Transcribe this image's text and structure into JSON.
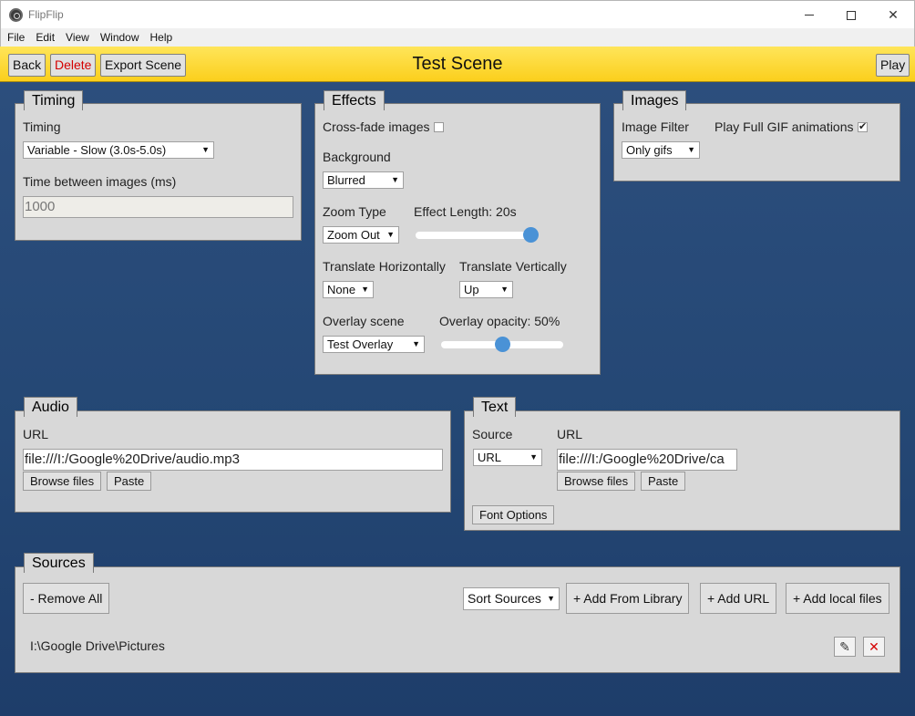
{
  "window": {
    "app_title": "FlipFlip",
    "menu": [
      "File",
      "Edit",
      "View",
      "Window",
      "Help"
    ]
  },
  "header": {
    "back_label": "Back",
    "delete_label": "Delete",
    "export_label": "Export Scene",
    "title": "Test Scene",
    "play_label": "Play"
  },
  "timing": {
    "tab": "Timing",
    "timing_label": "Timing",
    "timing_value": "Variable - Slow (3.0s-5.0s)",
    "between_label": "Time between images (ms)",
    "between_value": "1000"
  },
  "effects": {
    "tab": "Effects",
    "crossfade_label": "Cross-fade images",
    "crossfade_checked": false,
    "background_label": "Background",
    "background_value": "Blurred",
    "zoom_label": "Zoom Type",
    "zoom_value": "Zoom Out",
    "effect_length_label": "Effect Length: 20s",
    "effect_length_fraction": 1.0,
    "translate_h_label": "Translate Horizontally",
    "translate_h_value": "None",
    "translate_v_label": "Translate Vertically",
    "translate_v_value": "Up",
    "overlay_label": "Overlay scene",
    "overlay_value": "Test Overlay",
    "overlay_opacity_label": "Overlay opacity: 50%",
    "overlay_opacity_fraction": 0.5
  },
  "images": {
    "tab": "Images",
    "filter_label": "Image Filter",
    "filter_value": "Only gifs",
    "gif_label": "Play Full GIF animations",
    "gif_checked": true
  },
  "audio": {
    "tab": "Audio",
    "url_label": "URL",
    "url_value": "file:///I:/Google%20Drive/audio.mp3",
    "browse_label": "Browse files",
    "paste_label": "Paste"
  },
  "text": {
    "tab": "Text",
    "source_label": "Source",
    "source_value": "URL",
    "url_label": "URL",
    "url_value": "file:///I:/Google%20Drive/ca",
    "browse_label": "Browse files",
    "paste_label": "Paste",
    "font_options_label": "Font Options"
  },
  "sources": {
    "tab": "Sources",
    "remove_all_label": "- Remove All",
    "sort_value": "Sort Sources",
    "add_library_label": "+ Add From Library",
    "add_url_label": "+ Add URL",
    "add_local_label": "+ Add local files",
    "items": [
      {
        "path": "I:\\Google Drive\\Pictures"
      }
    ]
  },
  "colors": {
    "header_yellow": "#fbd734",
    "delete_red": "#d40000",
    "background_blue": "#2a4a78",
    "panel_gray": "#d8d8d8",
    "slider_blue": "#4a92d6"
  },
  "icons": {
    "edit": "pencil-icon",
    "remove": "close-icon",
    "app": "flipflip-logo-icon"
  }
}
